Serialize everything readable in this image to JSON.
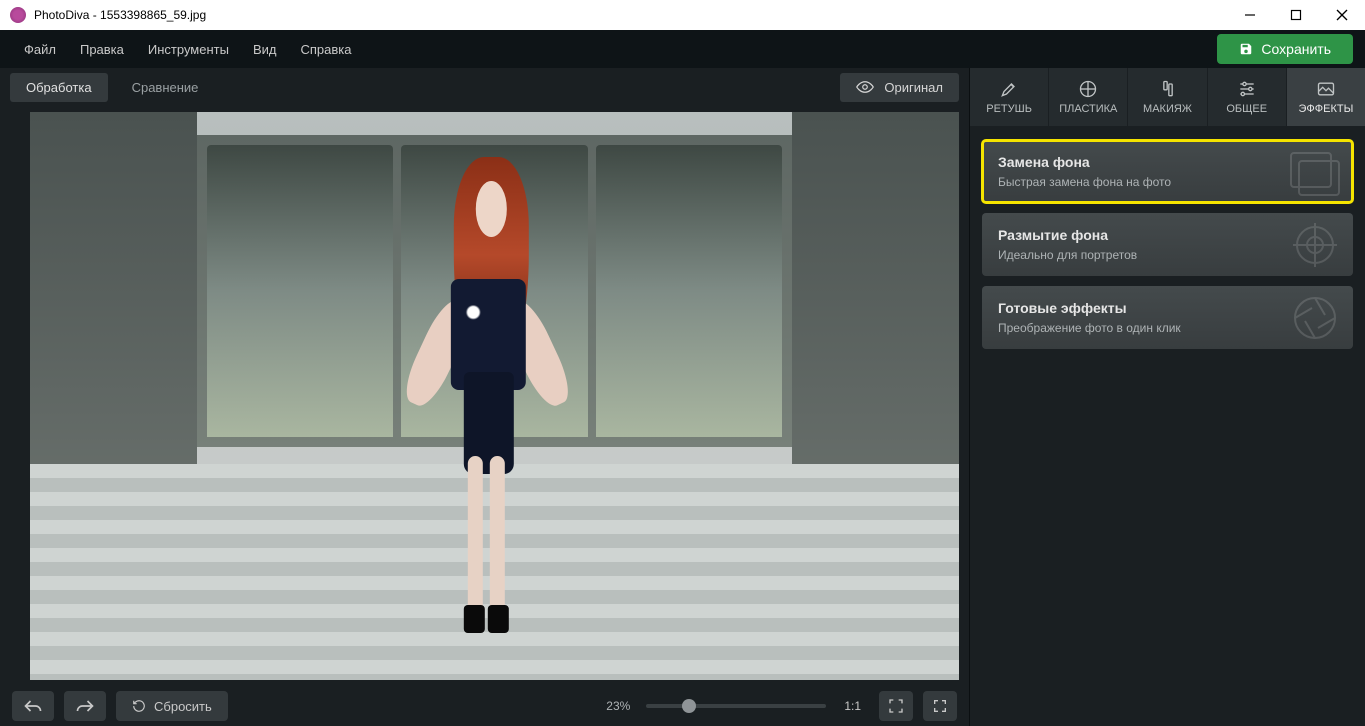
{
  "titlebar": {
    "app": "PhotoDiva",
    "file": "1553398865_59.jpg"
  },
  "menu": {
    "file": "Файл",
    "edit": "Правка",
    "tools": "Инструменты",
    "view": "Вид",
    "help": "Справка"
  },
  "save_label": "Сохранить",
  "view_tabs": {
    "edit": "Обработка",
    "compare": "Сравнение",
    "original": "Оригинал"
  },
  "bottom": {
    "reset": "Сбросить",
    "zoom": "23%",
    "one": "1:1"
  },
  "tooltabs": {
    "retouch": "РЕТУШЬ",
    "plastic": "ПЛАСТИКА",
    "makeup": "МАКИЯЖ",
    "general": "ОБЩЕЕ",
    "effects": "ЭФФЕКТЫ"
  },
  "effects": [
    {
      "title": "Замена фона",
      "sub": "Быстрая замена фона на фото"
    },
    {
      "title": "Размытие фона",
      "sub": "Идеально для портретов"
    },
    {
      "title": "Готовые эффекты",
      "sub": "Преображение фото в один клик"
    }
  ]
}
